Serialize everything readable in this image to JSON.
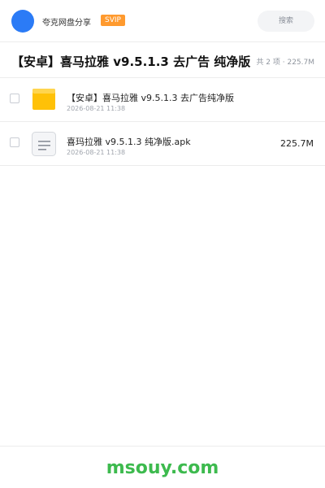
{
  "header": {
    "brand": "夸克网盘分享",
    "badge": "SVIP",
    "search_label": "搜索"
  },
  "share": {
    "title": "【安卓】喜马拉雅 v9.5.1.3 去广告 纯净版",
    "summary": "共 2 项 · 225.7M"
  },
  "files": [
    {
      "name": "【安卓】喜马拉雅 v9.5.1.3 去广告纯净版",
      "date": "2026-08-21 11:38",
      "size": "",
      "icon": "folder-icon"
    },
    {
      "name": "喜玛拉雅 v9.5.1.3 纯净版.apk",
      "date": "2026-08-21 11:38",
      "size": "225.7M",
      "icon": "file-icon"
    }
  ],
  "footer": {
    "watermark": "msouy.com"
  },
  "colors": {
    "accent": "#2b7bf6",
    "badge": "#ff9a2e",
    "folder": "#ffc107",
    "watermark": "#3dba4e"
  }
}
